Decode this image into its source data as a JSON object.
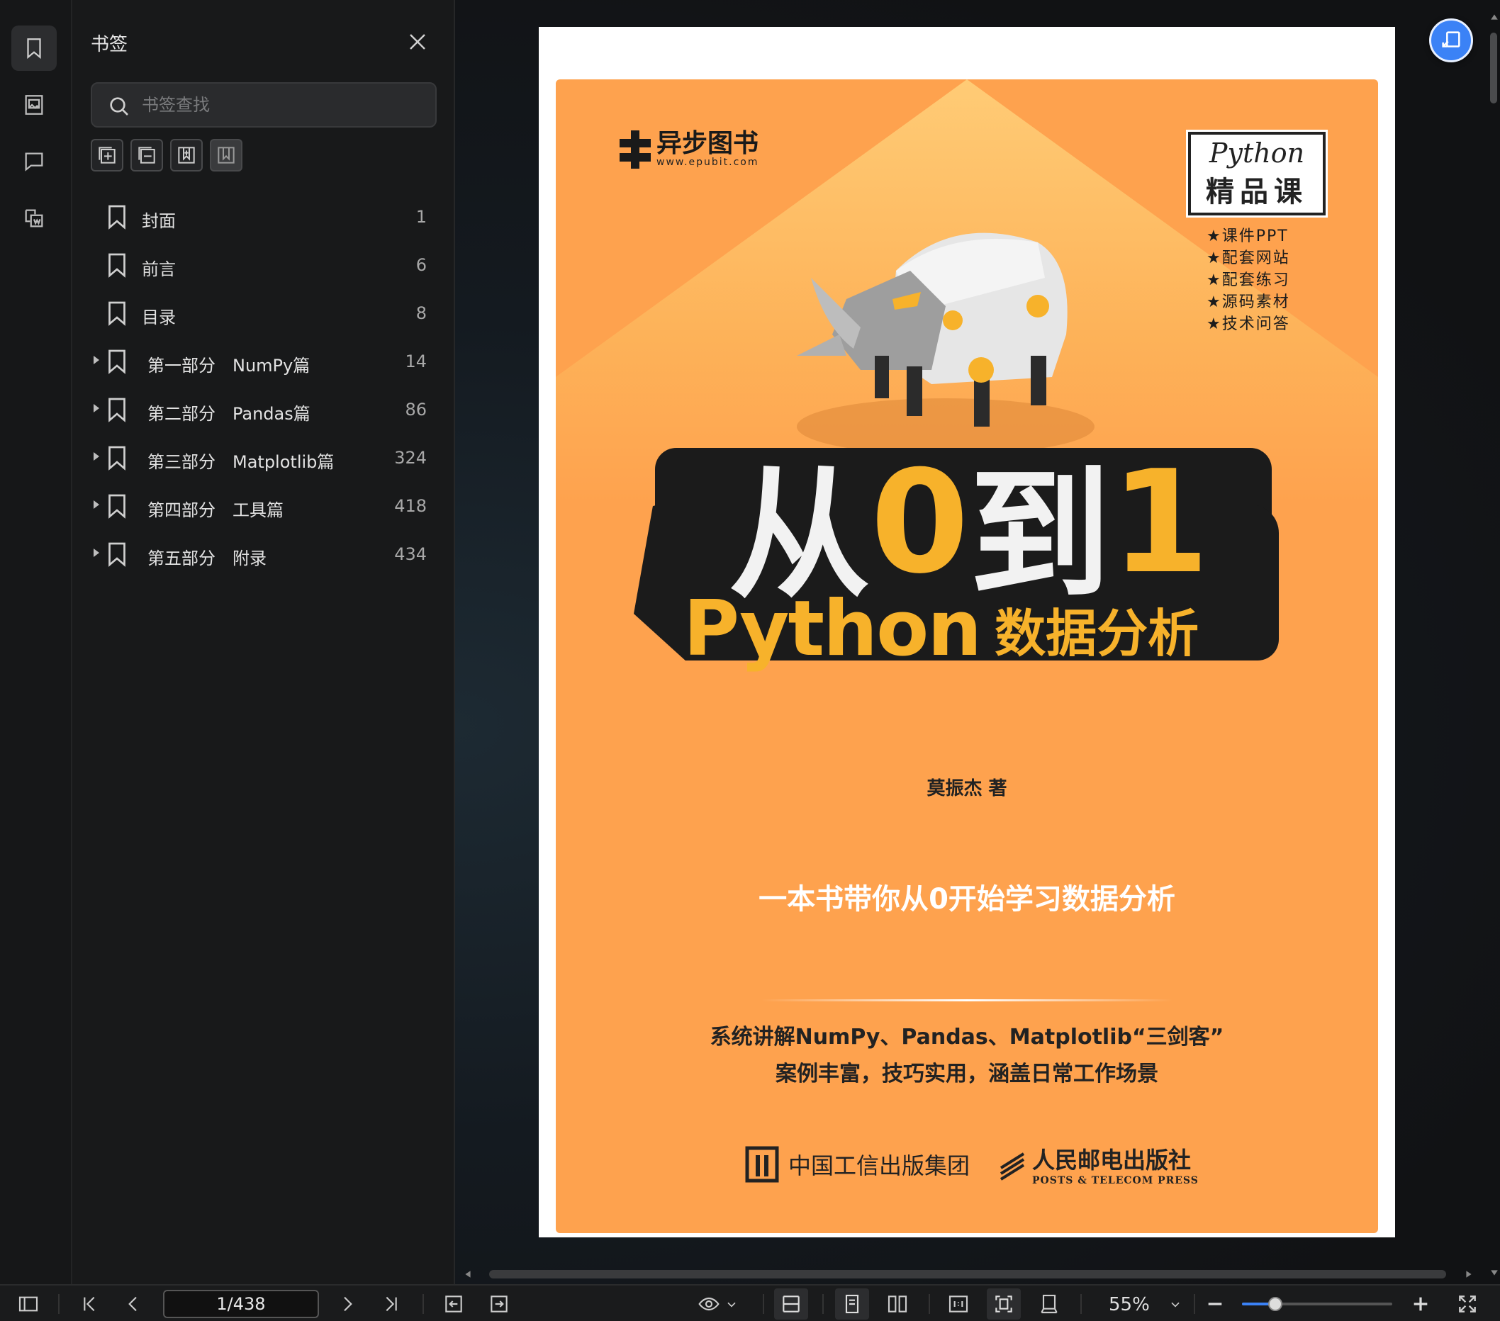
{
  "sidebar": {
    "title": "书签",
    "search_placeholder": "书签查找",
    "bookmarks": [
      {
        "label": "封面",
        "page": "1",
        "expandable": false
      },
      {
        "label": "前言",
        "page": "6",
        "expandable": false
      },
      {
        "label": "目录",
        "page": "8",
        "expandable": false
      },
      {
        "label": "第一部分　NumPy篇",
        "page": "14",
        "expandable": true
      },
      {
        "label": "第二部分　Pandas篇",
        "page": "86",
        "expandable": true
      },
      {
        "label": "第三部分　Matplotlib篇",
        "page": "324",
        "expandable": true
      },
      {
        "label": "第四部分　工具篇",
        "page": "418",
        "expandable": true
      },
      {
        "label": "第五部分　附录",
        "page": "434",
        "expandable": true
      }
    ]
  },
  "cover": {
    "publisher_brand": "异步图书",
    "publisher_url": "www.epubit.com",
    "course_badge_en": "Python",
    "course_badge_cn": "精品课",
    "features": [
      "★课件PPT",
      "★配套网站",
      "★配套练习",
      "★源码素材",
      "★技术问答"
    ],
    "title_part1": "从",
    "title_zero": "0",
    "title_part2": "到",
    "title_one": "1",
    "subtitle_en": "Python",
    "subtitle_cn": "数据分析",
    "author": "莫振杰 著",
    "slogan": "一本书带你从0开始学习数据分析",
    "desc_line1": "系统讲解NumPy、Pandas、Matplotlib“三剑客”",
    "desc_line2": "案例丰富，技巧实用，涵盖日常工作场景",
    "publisher1": "中国工信出版集团",
    "publisher2_cn": "人民邮电出版社",
    "publisher2_en": "POSTS & TELECOM PRESS"
  },
  "toolbar": {
    "page_indicator": "1/438",
    "zoom": "55%",
    "zoom_level_fraction": 0.22
  },
  "colors": {
    "accent": "#3b82f6",
    "cover_orange": "#fea24e",
    "title_gold": "#f7b22b"
  }
}
